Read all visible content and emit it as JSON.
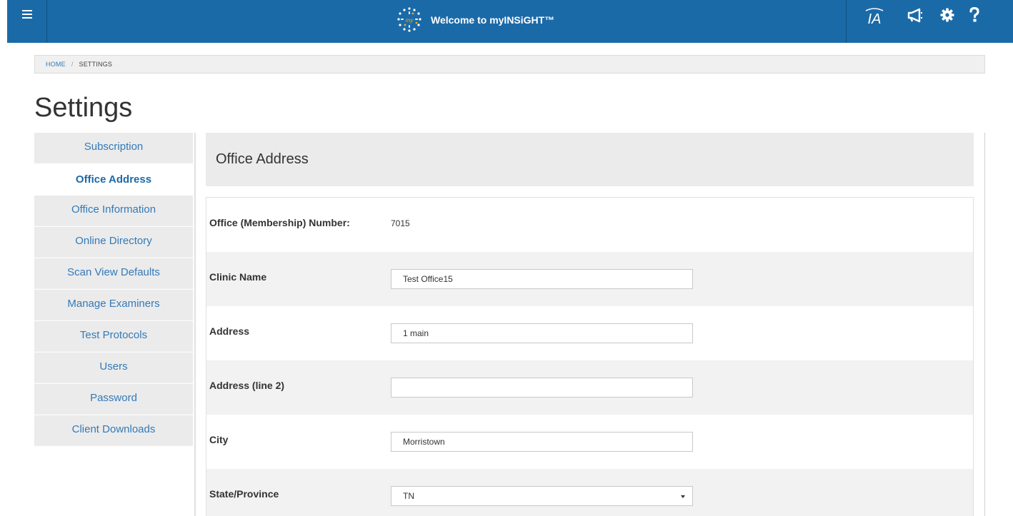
{
  "header": {
    "title": "Welcome to myINSiGHT™",
    "logo_text": "my",
    "ia_label": "IA"
  },
  "breadcrumb": {
    "home": "HOME",
    "separator": "/",
    "current": "SETTINGS"
  },
  "page": {
    "title": "Settings"
  },
  "sidebar": {
    "items": [
      {
        "label": "Subscription"
      },
      {
        "label": "Office Address"
      },
      {
        "label": "Office Information"
      },
      {
        "label": "Online Directory"
      },
      {
        "label": "Scan View Defaults"
      },
      {
        "label": "Manage Examiners"
      },
      {
        "label": "Test Protocols"
      },
      {
        "label": "Users"
      },
      {
        "label": "Password"
      },
      {
        "label": "Client Downloads"
      }
    ],
    "active": "Office Address"
  },
  "section": {
    "title": "Office Address"
  },
  "form": {
    "membership_label": "Office (Membership) Number:",
    "membership_value": "7015",
    "clinic_name_label": "Clinic Name",
    "clinic_name_value": "Test Office15",
    "address_label": "Address",
    "address_value": "1 main",
    "address2_label": "Address (line 2)",
    "address2_value": "",
    "city_label": "City",
    "city_value": "Morristown",
    "state_label": "State/Province",
    "state_value": "TN"
  },
  "icons": {
    "menu": "hamburger-icon",
    "ia": "ia-icon",
    "announcement": "megaphone-icon",
    "settings": "gear-icon",
    "help": "question-icon"
  },
  "colors": {
    "header_bg": "#1b6aa8",
    "link": "#337ab7",
    "logo_accent": "#f5a623"
  }
}
